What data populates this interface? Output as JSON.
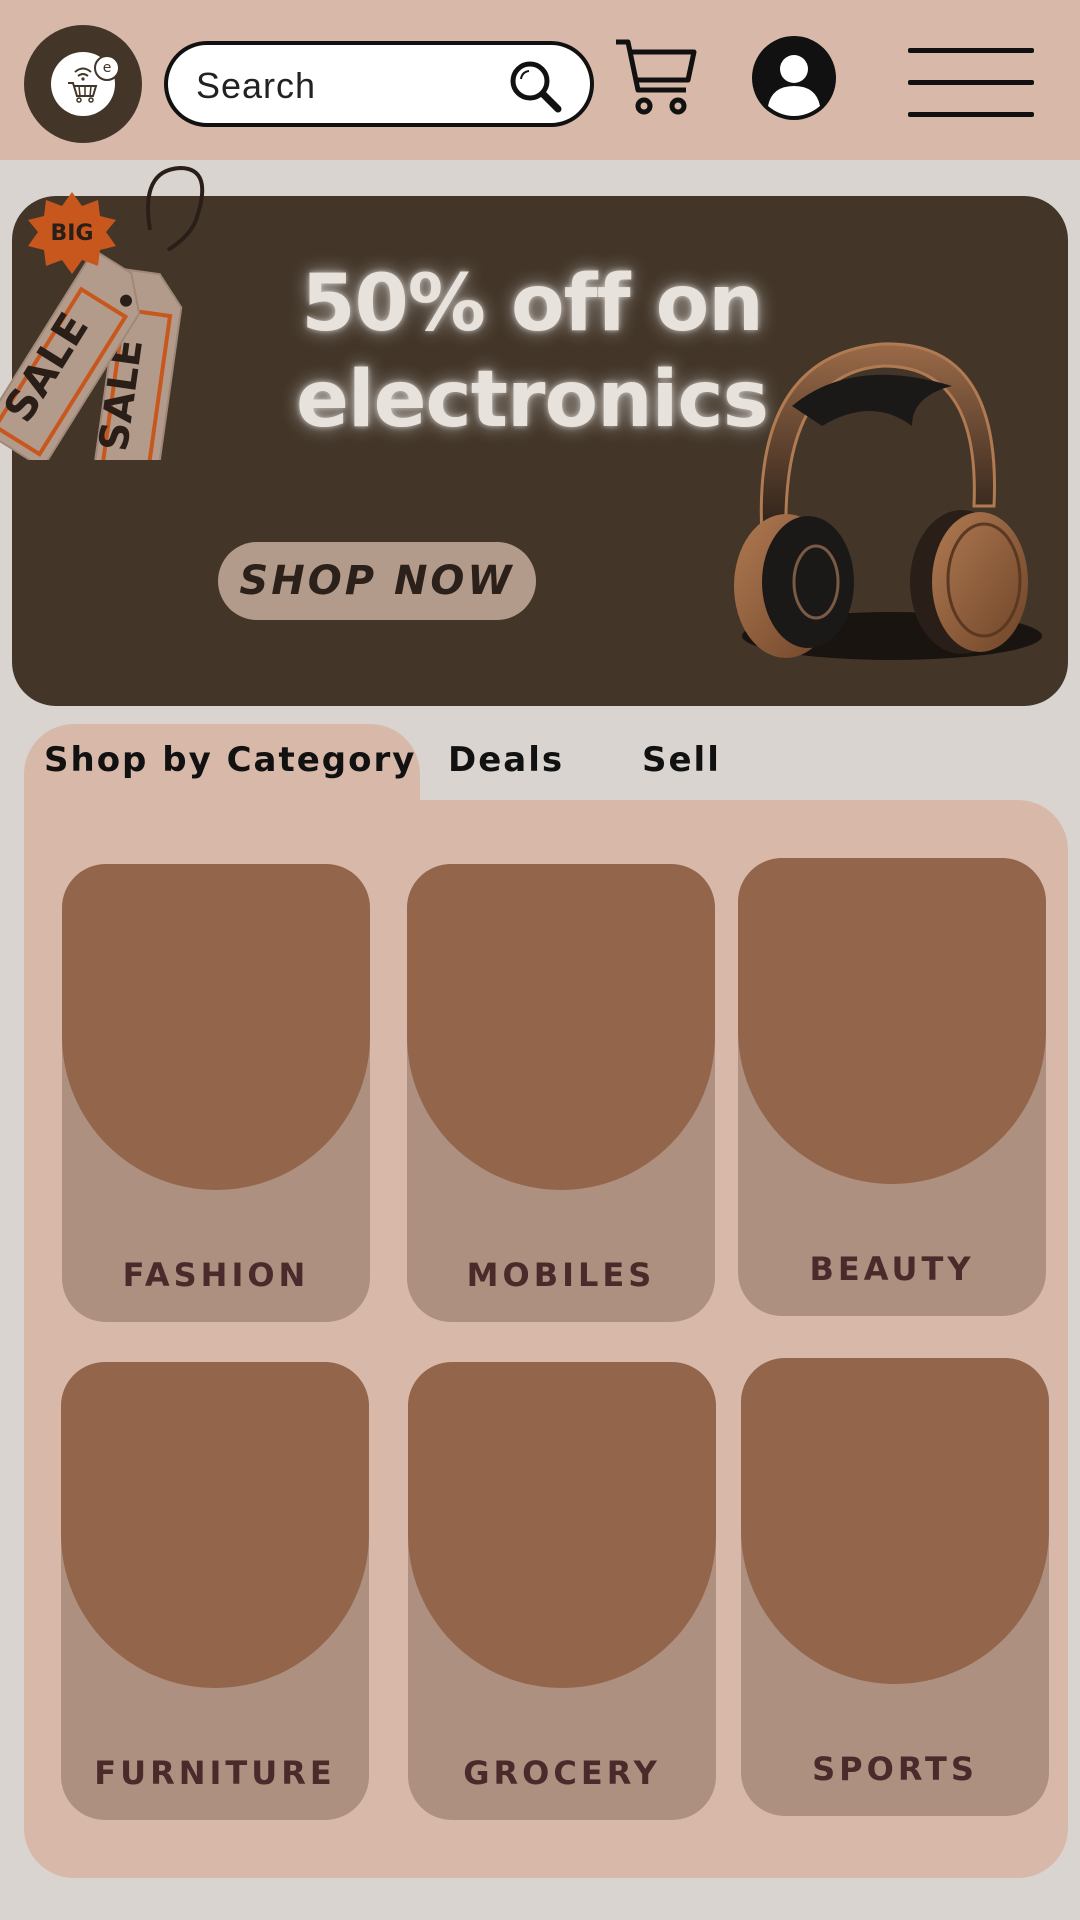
{
  "header": {
    "logo_badge": "e",
    "search_placeholder": "Search"
  },
  "banner": {
    "title": "50% off on electronics",
    "cta": "SHOP NOW",
    "tag_big": "BIG",
    "tag_sale": "SALE"
  },
  "tabs": [
    {
      "label": "Shop by Category",
      "active": true
    },
    {
      "label": "Deals",
      "active": false
    },
    {
      "label": "Sell",
      "active": false
    }
  ],
  "categories": [
    {
      "label": "FASHION"
    },
    {
      "label": "MOBILES"
    },
    {
      "label": "BEAUTY"
    },
    {
      "label": "FURNITURE"
    },
    {
      "label": "GROCERY"
    },
    {
      "label": "SPORTS"
    }
  ],
  "colors": {
    "header_bg": "#d8b9a9",
    "page_bg": "#d9d4cf",
    "banner_bg": "#433629",
    "card_bg": "#ad9080",
    "card_image": "#93654b",
    "accent_orange": "#c8571e"
  }
}
